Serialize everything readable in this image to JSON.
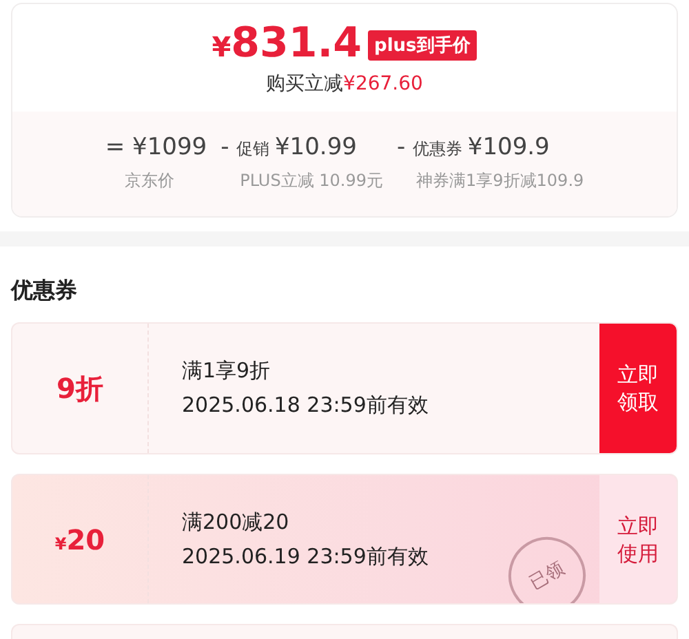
{
  "price": {
    "currency": "¥",
    "amount": "831.4",
    "badge": "plus到手价",
    "saving_label": "购买立减",
    "saving_value": "¥267.60"
  },
  "breakdown": [
    {
      "op": "=",
      "value": "¥1099",
      "note": "京东价"
    },
    {
      "op": "-",
      "label": "促销",
      "value": "¥10.99",
      "note": "PLUS立减 10.99元"
    },
    {
      "op": "-",
      "label": "优惠券",
      "value": "¥109.9",
      "note": "神券满1享9折减109.9"
    }
  ],
  "coupons_title": "优惠券",
  "coupons": [
    {
      "amount": "9折",
      "condition": "满1享9折",
      "validity": "2025.06.18 23:59前有效",
      "action": "立即领取",
      "claimed": false
    },
    {
      "currency": "¥",
      "amount": "20",
      "condition": "满200减20",
      "validity": "2025.06.19 23:59前有效",
      "action": "立即使用",
      "claimed": true,
      "stamp": "已领"
    }
  ]
}
